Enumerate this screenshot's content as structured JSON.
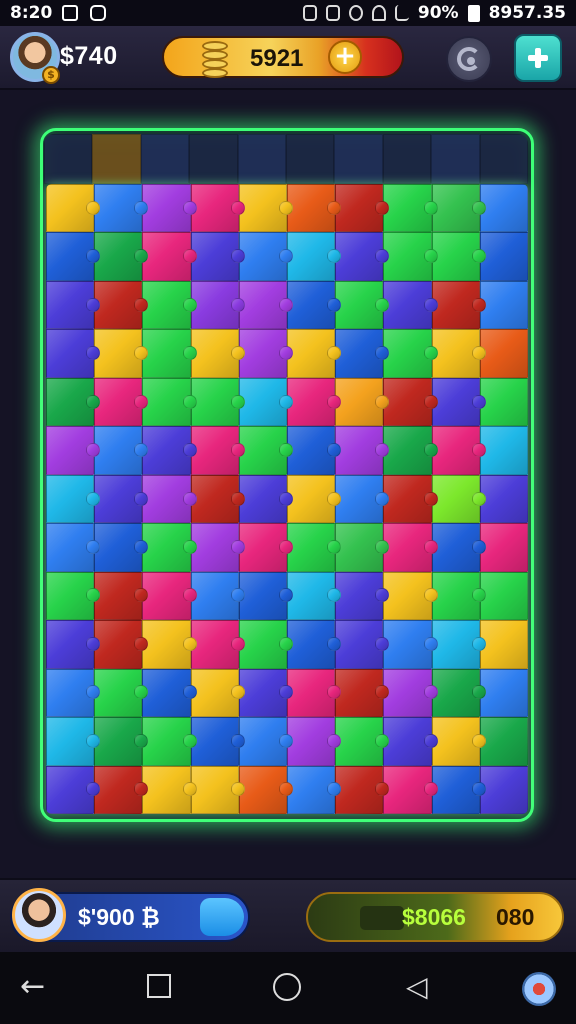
{
  "status_bar": {
    "time": "8:20",
    "battery_text": "90%",
    "right_text": "8957.35",
    "icons": [
      "close-box-icon",
      "camera-icon",
      "vibrate-icon",
      "sim-icon",
      "info-icon",
      "wifi-icon",
      "signal-icon",
      "battery-icon"
    ]
  },
  "top_hud": {
    "cash": "$740",
    "coins": "5921",
    "plus_symbol": "+",
    "avatar_badge": "$",
    "icons": [
      "avatar-icon",
      "coin-stack-icon",
      "plus-coin-icon",
      "settings-icon",
      "add-icon"
    ]
  },
  "board": {
    "columns": 10,
    "rows": 13,
    "top_strip": [
      "#1e2a48",
      "#7a5a1c",
      "#22335e",
      "#1e2a48",
      "#22335e",
      "#1e2a48",
      "#22335e",
      "#1e2a48",
      "#22335e",
      "#1e2a48"
    ],
    "cells": [
      "#f4c21e",
      "#2f7ef0",
      "#a23de0",
      "#e8267d",
      "#f4c21e",
      "#e85b18",
      "#c0281f",
      "#27d34a",
      "#34c24f",
      "#2f7ef0",
      "#1f5fd8",
      "#19a84a",
      "#e8267d",
      "#4c3dd8",
      "#2f7ef0",
      "#1fb8e8",
      "#4c3dd8",
      "#27d34a",
      "#27d34a",
      "#1f5fd8",
      "#4c3dd8",
      "#c0281f",
      "#27d34a",
      "#8a3be0",
      "#a23de0",
      "#1f5fd8",
      "#27d34a",
      "#4c3dd8",
      "#c0281f",
      "#2f7ef0",
      "#4c3dd8",
      "#f4c21e",
      "#27d34a",
      "#f4c21e",
      "#a23de0",
      "#f4c21e",
      "#1f5fd8",
      "#27d34a",
      "#f4c21e",
      "#e85b18",
      "#19a84a",
      "#e8267d",
      "#27d34a",
      "#27d34a",
      "#1fb8e8",
      "#e8267d",
      "#f4a21e",
      "#c0281f",
      "#4c3dd8",
      "#27d34a",
      "#a23de0",
      "#2f7ef0",
      "#4c3dd8",
      "#e8267d",
      "#27d34a",
      "#1f5fd8",
      "#a23de0",
      "#19a84a",
      "#e8267d",
      "#1fb8e8",
      "#1fb8e8",
      "#4c3dd8",
      "#a23de0",
      "#c0281f",
      "#4c3dd8",
      "#f4c21e",
      "#2f7ef0",
      "#c0281f",
      "#7ce82c",
      "#4c3dd8",
      "#2f7ef0",
      "#1f5fd8",
      "#27d34a",
      "#a23de0",
      "#e8267d",
      "#27d34a",
      "#34c24f",
      "#e8267d",
      "#1f5fd8",
      "#e8267d",
      "#27d34a",
      "#c0281f",
      "#e8267d",
      "#2f7ef0",
      "#1f5fd8",
      "#1fb8e8",
      "#4c3dd8",
      "#f4c21e",
      "#27d34a",
      "#27d34a",
      "#4c3dd8",
      "#c0281f",
      "#f4c21e",
      "#e8267d",
      "#27d34a",
      "#1f5fd8",
      "#4c3dd8",
      "#2f7ef0",
      "#1fb8e8",
      "#f4c21e",
      "#2f7ef0",
      "#27d34a",
      "#1f5fd8",
      "#f4c21e",
      "#4c3dd8",
      "#e8267d",
      "#c0281f",
      "#a23de0",
      "#19a84a",
      "#2f7ef0",
      "#1fb8e8",
      "#19a84a",
      "#27d34a",
      "#1f5fd8",
      "#2f7ef0",
      "#a23de0",
      "#27d34a",
      "#4c3dd8",
      "#f4c21e",
      "#19a84a",
      "#4c3dd8",
      "#c0281f",
      "#f4c21e",
      "#f4c21e",
      "#e85b18",
      "#2f7ef0",
      "#c0281f",
      "#e8267d",
      "#1f5fd8",
      "#4c3dd8"
    ]
  },
  "bottom_hud": {
    "player_cash": "$'900 ₿",
    "reward_value": "$8066",
    "reward_suffix": "080",
    "icons": [
      "player-avatar-icon",
      "puzzle-piece-icon"
    ]
  },
  "nav_bar": {
    "back_glyph": "←",
    "recents_glyph": "◁",
    "icons": [
      "back-icon",
      "home-square-icon",
      "home-circle-icon",
      "recents-triangle-icon",
      "assistant-icon"
    ]
  }
}
